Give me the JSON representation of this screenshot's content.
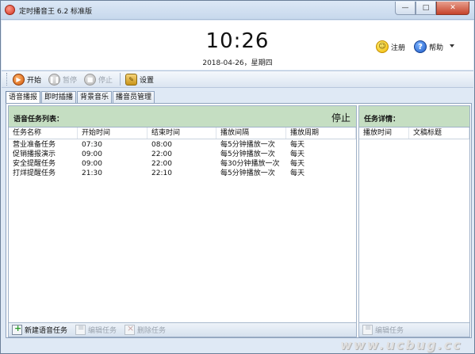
{
  "window": {
    "title": "定时播音王 6.2 标准版",
    "controls": {
      "minimize": "—",
      "maximize": "□",
      "close": "✕"
    }
  },
  "header": {
    "clock": "10:26",
    "date": "2018-04-26，星期四",
    "register_label": "注册",
    "help_label": "帮助",
    "register_icon": "smile-icon",
    "help_icon": "question-icon"
  },
  "toolbar": {
    "start_label": "开始",
    "pause_label": "暂停",
    "stop_label": "停止",
    "settings_label": "设置"
  },
  "tabs": [
    "语音播报",
    "即时插播",
    "背景音乐",
    "播音员管理"
  ],
  "task_list": {
    "title": "语音任务列表：",
    "status": "停止",
    "columns": [
      "任务名称",
      "开始时间",
      "结束时间",
      "播放间隔",
      "播放周期"
    ],
    "rows": [
      [
        "营业准备任务",
        "07:30",
        "08:00",
        "每5分钟播放一次",
        "每天"
      ],
      [
        "促销播报演示",
        "09:00",
        "22:00",
        "每5分钟播放一次",
        "每天"
      ],
      [
        "安全提醒任务",
        "09:00",
        "22:00",
        "每30分钟播放一次",
        "每天"
      ],
      [
        "打烊提醒任务",
        "21:30",
        "22:10",
        "每5分钟播放一次",
        "每天"
      ]
    ],
    "footer": {
      "new_label": "新建语音任务",
      "edit_label": "编辑任务",
      "delete_label": "删除任务"
    }
  },
  "task_detail": {
    "title": "任务详情：",
    "columns": [
      "播放时间",
      "文稿标题"
    ],
    "footer": {
      "edit_label": "编辑任务"
    }
  },
  "watermark": "www.ucbug.cc",
  "colors": {
    "pane_header": "#c5dec2",
    "window_bg": "#dfe9f5",
    "accent_orange": "#d2580a"
  }
}
